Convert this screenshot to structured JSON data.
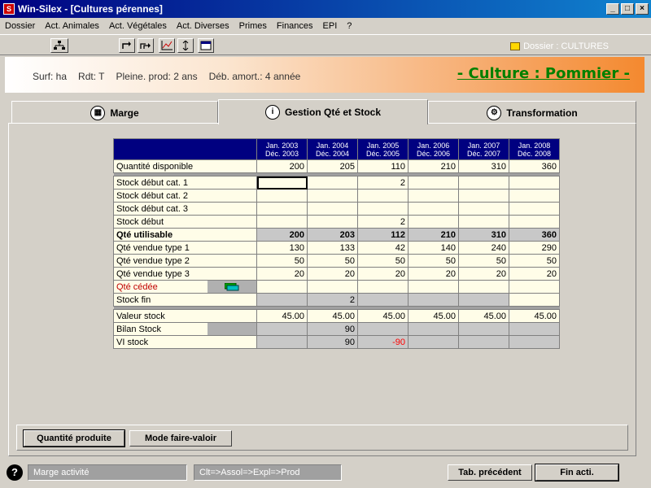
{
  "window": {
    "title": "Win-Silex - [Cultures pérennes]",
    "app_icon": "silex-app-icon"
  },
  "menu": [
    "Dossier",
    "Act. Animales",
    "Act. Végétales",
    "Act. Diverses",
    "Primes",
    "Finances",
    "EPI",
    "?"
  ],
  "toolbar": {
    "dossier": "Dossier : CULTURES"
  },
  "banner": {
    "surf": "Surf: ha",
    "rdt": "Rdt: T",
    "pleine": "Pleine. prod: 2 ans",
    "deb": "Déb. amort.: 4 année",
    "culture": "- Culture : Pommier -"
  },
  "tabs": [
    {
      "label": "Marge",
      "icon": "calculator-icon"
    },
    {
      "label": "Gestion Qté et Stock",
      "icon": "info-icon"
    },
    {
      "label": "Transformation",
      "icon": "factory-icon"
    }
  ],
  "grid": {
    "headers": [
      [
        "Jan. 2003",
        "Déc. 2003"
      ],
      [
        "Jan. 2004",
        "Déc. 2004"
      ],
      [
        "Jan. 2005",
        "Déc. 2005"
      ],
      [
        "Jan. 2006",
        "Déc. 2006"
      ],
      [
        "Jan. 2007",
        "Déc. 2007"
      ],
      [
        "Jan. 2008",
        "Déc. 2008"
      ]
    ],
    "rows": {
      "qte_dispo": {
        "label": "Quantité disponible",
        "values": [
          "200",
          "205",
          "110",
          "210",
          "310",
          "360"
        ]
      },
      "stock_cat1": {
        "label": "Stock début cat. 1",
        "values": [
          "",
          "",
          "2",
          "",
          "",
          ""
        ]
      },
      "stock_cat2": {
        "label": "Stock début cat. 2",
        "values": [
          "",
          "",
          "",
          "",
          "",
          ""
        ]
      },
      "stock_cat3": {
        "label": "Stock début cat. 3",
        "values": [
          "",
          "",
          "",
          "",
          "",
          ""
        ]
      },
      "stock_debut": {
        "label": "Stock début",
        "values": [
          "",
          "",
          "2",
          "",
          "",
          ""
        ]
      },
      "qte_util": {
        "label": "Qté utilisable",
        "values": [
          "200",
          "203",
          "112",
          "210",
          "310",
          "360"
        ]
      },
      "vendue1": {
        "label": "Qté vendue type 1",
        "values": [
          "130",
          "133",
          "42",
          "140",
          "240",
          "290"
        ]
      },
      "vendue2": {
        "label": "Qté vendue type 2",
        "values": [
          "50",
          "50",
          "50",
          "50",
          "50",
          "50"
        ]
      },
      "vendue3": {
        "label": "Qté vendue type 3",
        "values": [
          "20",
          "20",
          "20",
          "20",
          "20",
          "20"
        ]
      },
      "cedee": {
        "label": "Qté cédée",
        "values": [
          "",
          "",
          "",
          "",
          "",
          ""
        ]
      },
      "stock_fin": {
        "label": "Stock fin",
        "values": [
          "",
          "2",
          "",
          "",
          "",
          ""
        ]
      },
      "valeur": {
        "label": "Valeur stock",
        "values": [
          "45.00",
          "45.00",
          "45.00",
          "45.00",
          "45.00",
          "45.00"
        ]
      },
      "bilan": {
        "label": "Bilan Stock",
        "values": [
          "",
          "90",
          "",
          "",
          "",
          ""
        ]
      },
      "vi": {
        "label": "VI stock",
        "values": [
          "",
          "90",
          "-90",
          "",
          "",
          ""
        ]
      }
    }
  },
  "buttons": {
    "qte_produite": "Quantité produite",
    "mode_fv": "Mode faire-valoir"
  },
  "status": {
    "marge": "Marge activité",
    "path": "Clt=>Assol=>Expl=>Prod",
    "prev": "Tab. précédent",
    "fin": "Fin acti."
  },
  "colors": {
    "header_bg": "#000080",
    "cell_bg": "#fffde8",
    "culture_text": "#008000",
    "negative": "#ff0000"
  }
}
